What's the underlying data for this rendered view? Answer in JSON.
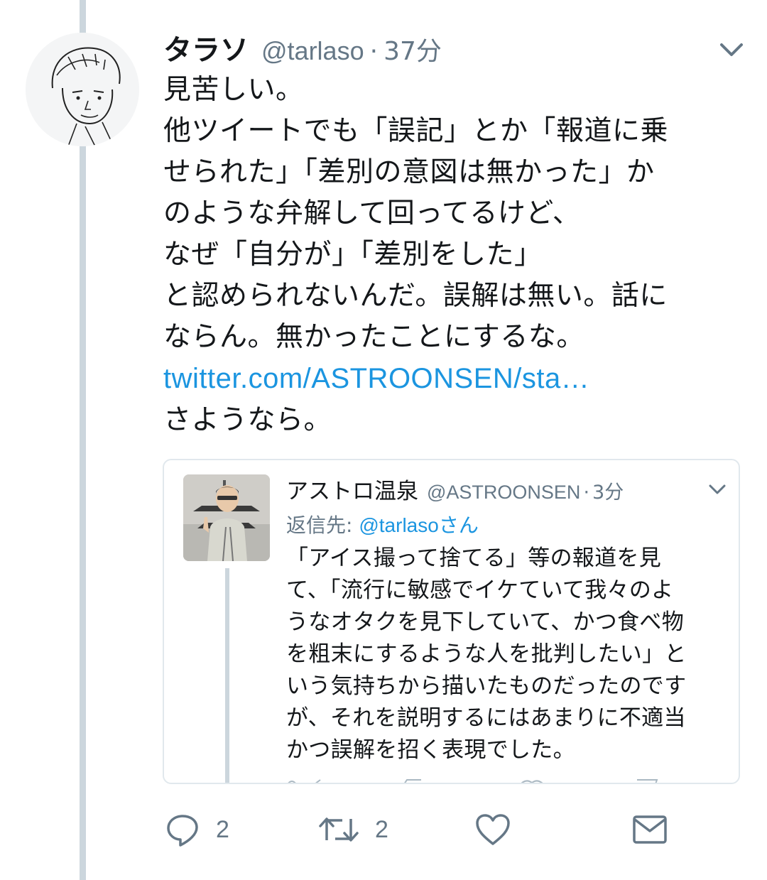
{
  "tweet": {
    "display_name": "タラソ",
    "handle": "@tarlaso",
    "separator": "·",
    "time": "37分",
    "lines": [
      "見苦しい。",
      "他ツイートでも「誤記」とか「報道に乗",
      "せられた」「差別の意図は無かった」か",
      "のような弁解して回ってるけど、",
      "なぜ「自分が」「差別をした」",
      "と認められないんだ。誤解は無い。話に",
      "ならん。無かったことにするな。"
    ],
    "link": "twitter.com/ASTROONSEN/sta…",
    "closing": "さようなら。"
  },
  "quote": {
    "display_name": "アストロ温泉",
    "handle": "@ASTROONSEN",
    "separator": "·",
    "time": "3分",
    "reply_prefix": "返信先: ",
    "reply_user": "@tarlaso",
    "reply_suffix": "さん",
    "lines": [
      "「アイス撮って捨てる」等の報道を見",
      "て、「流行に敏感でイケていて我々のよ",
      "うなオタクを見下していて、かつ食べ物",
      "を粗末にするような人を批判したい」と",
      "いう気持ちから描いたものだったのです",
      "が、それを説明するにはあまりに不適当",
      "かつ誤解を招く表現でした。"
    ]
  },
  "actions": {
    "reply_count": "2",
    "retweet_count": "2"
  },
  "icons": [
    "chevron-down-icon",
    "reply-icon",
    "retweet-icon",
    "like-icon",
    "message-icon"
  ],
  "colors": {
    "link": "#1b95e0",
    "secondary_text": "#657786",
    "thread_line": "#ccd6dd",
    "border": "#e1e8ed"
  }
}
